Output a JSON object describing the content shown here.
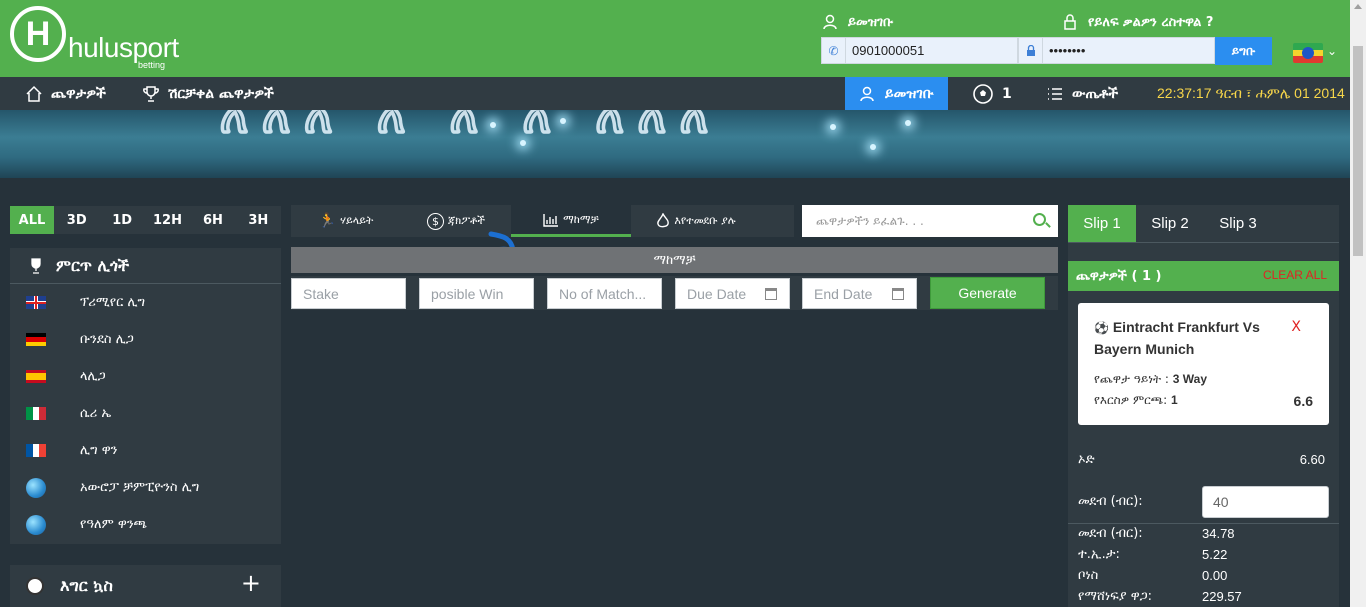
{
  "header": {
    "logo_text": "hulusport",
    "logo_sub": "betting",
    "login_label": "ይመዝገቡ",
    "forgot_label": "የይለፍ ቃልዎን ረስተዋል ?",
    "phone_value": "0901000051",
    "password_value": "••••••••",
    "login_button": "ይግቡ"
  },
  "nav": {
    "games": "ጨዋታዎች",
    "top_games": "ሽርቻቀል ጨዋታዎች",
    "register": "ይመዝገቡ",
    "bet_count": "1",
    "results": "ውጤቶች",
    "clock": "22:37:17",
    "date_prefix": "ዓርብ ፣ ሐምሌ 01 2014"
  },
  "time_filters": [
    "ALL",
    "3D",
    "1D",
    "12H",
    "6H",
    "3H"
  ],
  "leagues": {
    "title": "ምርጥ ሊጎች",
    "items": [
      {
        "label": "ፕሪሚየር ሊግ",
        "flag": "england"
      },
      {
        "label": "ቡንደስ ሊጋ",
        "flag": "germany"
      },
      {
        "label": "ላሊጋ",
        "flag": "spain"
      },
      {
        "label": "ሴሪ ኤ",
        "flag": "italy"
      },
      {
        "label": "ሊግ ዋን",
        "flag": "france"
      },
      {
        "label": "አውሮፓ ቻምፒዮንስ ሊግ",
        "flag": "globe"
      },
      {
        "label": "የዓለም ዋንጫ",
        "flag": "globe"
      }
    ]
  },
  "sport": {
    "label": "እግር ኳስ",
    "plus": "+"
  },
  "center": {
    "tabs": [
      {
        "label": "ሃይላይት",
        "icon": "runner-icon"
      },
      {
        "label": "ጃክፖቶች",
        "icon": "dollar-icon"
      },
      {
        "label": "ማከማቻ",
        "icon": "chart-icon"
      },
      {
        "label": "እየተመደቡ ያሉ",
        "icon": "flame-icon"
      }
    ],
    "search_placeholder": "ጨዋታዎችን ይፈልጉ. . .",
    "section_title": "ማከማቻ",
    "stake_placeholder": "Stake",
    "win_placeholder": "posible Win",
    "matches_placeholder": "No of Match...",
    "due_placeholder": "Due Date",
    "end_placeholder": "End Date",
    "generate": "Generate"
  },
  "slip": {
    "tabs": [
      "Slip 1",
      "Slip 2",
      "Slip 3"
    ],
    "games_label": "ጨዋታዎች ( 1 )",
    "clear": "CLEAR ALL",
    "match": "Eintracht Frankfurt Vs Bayern Munich",
    "remove": "X",
    "type_label": "የጨዋታ ዓይነት :",
    "type_value": "3 Way",
    "pick_label": "የእርስዎ ምርጫ:",
    "pick_value": "1",
    "pick_odd": "6.6",
    "total_odd_label": "ኦድ",
    "total_odd": "6.60",
    "stake_label": "መደብ (ብር):",
    "stake_value": "40",
    "net_label": "መደብ (ብር):",
    "net_value": "34.78",
    "tax_label": "ተ.ኢ.ታ:",
    "tax_value": "5.22",
    "bonus_label": "ቦነስ",
    "bonus_value": "0.00",
    "win_label": "የማሸነፍያ ዋጋ:",
    "win_value": "229.57"
  }
}
